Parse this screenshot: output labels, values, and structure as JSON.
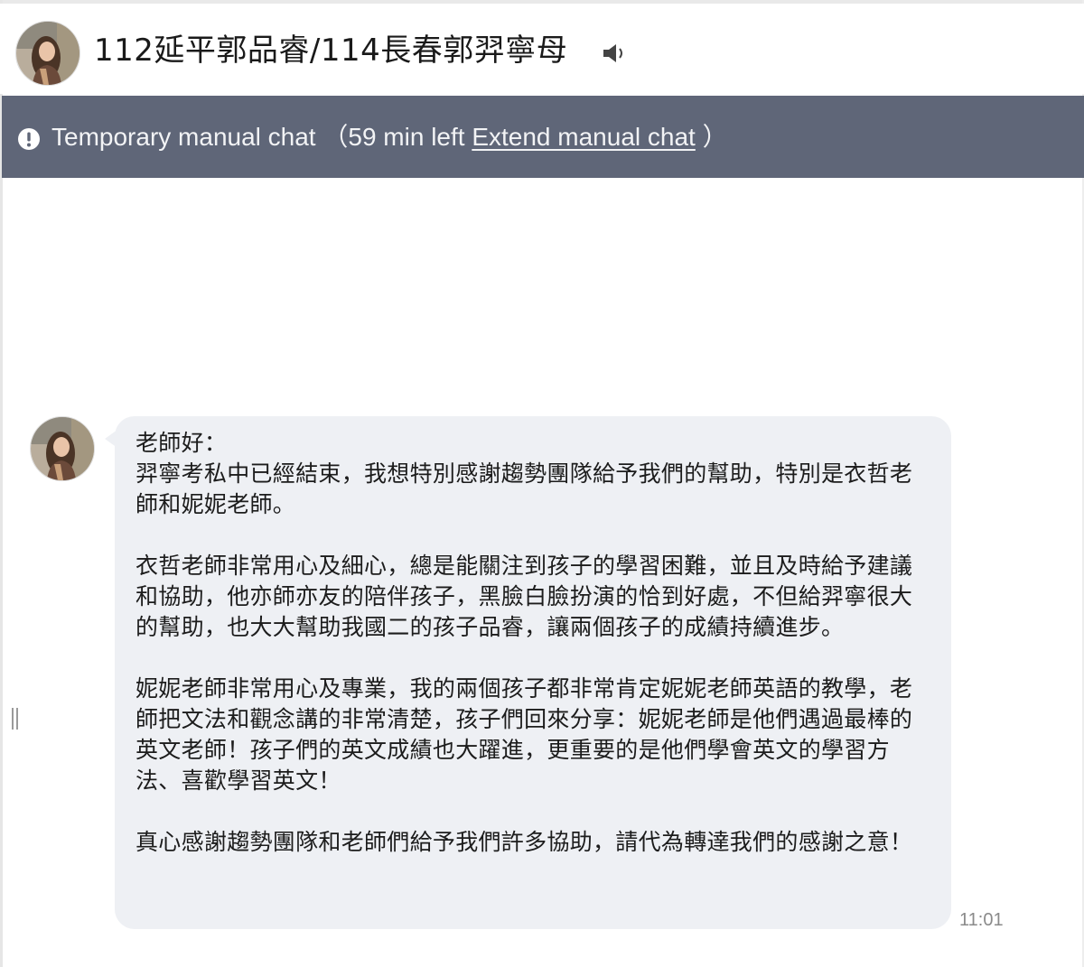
{
  "header": {
    "title": "112延平郭品睿/114長春郭羿寧母",
    "avatar_icon": "profile-photo",
    "speaker_icon": "speaker-icon"
  },
  "banner": {
    "icon": "exclamation-circle-icon",
    "label": "Temporary manual chat",
    "open_paren": "（",
    "time_left": "59 min left",
    "extend_link": "Extend manual chat",
    "close_paren": "）",
    "background": "#5f6678"
  },
  "message": {
    "lines": {
      "greeting": "老師好：",
      "p1": "羿寧考私中已經結束，我想特別感謝趨勢團隊給予我們的幫助，特別是衣哲老師和妮妮老師。",
      "p2": "衣哲老師非常用心及細心，總是能關注到孩子的學習困難，並且及時給予建議和協助，他亦師亦友的陪伴孩子，黑臉白臉扮演的恰到好處，不但給羿寧很大的幫助，也大大幫助我國二的孩子品睿，讓兩個孩子的成績持續進步。",
      "p3": "妮妮老師非常用心及專業，我的兩個孩子都非常肯定妮妮老師英語的教學，老師把文法和觀念講的非常清楚，孩子們回來分享：妮妮老師是他們遇過最棒的英文老師！孩子們的英文成績也大躍進，更重要的是他們學會英文的學習方法、喜歡學習英文！",
      "p4": "真心感謝趨勢團隊和老師們給予我們許多協助，請代為轉達我們的感謝之意！"
    },
    "timestamp": "11:01",
    "bubble_color": "#eef0f4"
  }
}
